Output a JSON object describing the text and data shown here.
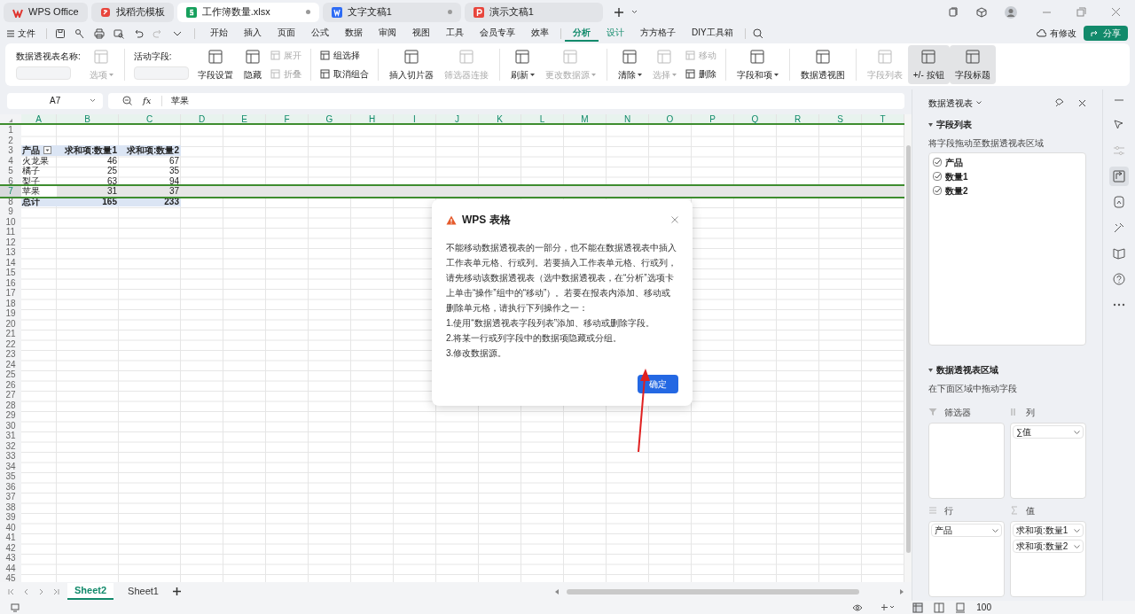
{
  "app_tabs": [
    {
      "label": "WPS Office",
      "kind": "wps",
      "selected": false,
      "unsaved": false
    },
    {
      "label": "找稻壳模板",
      "kind": "template",
      "selected": false,
      "unsaved": false
    },
    {
      "label": "工作簿数量.xlsx",
      "kind": "sheet",
      "selected": true,
      "unsaved": true
    },
    {
      "label": "文字文稿1",
      "kind": "doc",
      "selected": false,
      "unsaved": true
    },
    {
      "label": "演示文稿1",
      "kind": "slides",
      "selected": false,
      "unsaved": false
    }
  ],
  "menu": {
    "file": "文件",
    "tabs": [
      {
        "label": "开始",
        "selected": false,
        "contextual": false
      },
      {
        "label": "插入",
        "selected": false,
        "contextual": false
      },
      {
        "label": "页面",
        "selected": false,
        "contextual": false
      },
      {
        "label": "公式",
        "selected": false,
        "contextual": false
      },
      {
        "label": "数据",
        "selected": false,
        "contextual": false
      },
      {
        "label": "审阅",
        "selected": false,
        "contextual": false
      },
      {
        "label": "视图",
        "selected": false,
        "contextual": false
      },
      {
        "label": "工具",
        "selected": false,
        "contextual": false
      },
      {
        "label": "会员专享",
        "selected": false,
        "contextual": false
      },
      {
        "label": "效率",
        "selected": false,
        "contextual": false
      },
      {
        "label": "分析",
        "selected": true,
        "contextual": true
      },
      {
        "label": "设计",
        "selected": false,
        "contextual": true
      },
      {
        "label": "方方格子",
        "selected": false,
        "contextual": false
      },
      {
        "label": "DIY工具箱",
        "selected": false,
        "contextual": false
      }
    ],
    "cloud_status": "有修改",
    "share": "分享"
  },
  "ribbon": [
    {
      "kind": "field",
      "label": "数据透视表名称:"
    },
    {
      "kind": "large",
      "label": "选项",
      "disabled": true,
      "caret": true
    },
    {
      "kind": "separator"
    },
    {
      "kind": "field",
      "label": "活动字段:"
    },
    {
      "kind": "large",
      "label": "字段设置",
      "disabled": false,
      "caret": false
    },
    {
      "kind": "large",
      "label": "隐藏",
      "disabled": false,
      "caret": false
    },
    {
      "kind": "stack",
      "items": [
        {
          "label": "展开",
          "disabled": true
        },
        {
          "label": "折叠",
          "disabled": true
        }
      ]
    },
    {
      "kind": "separator"
    },
    {
      "kind": "stack",
      "items": [
        {
          "label": "组选择",
          "disabled": false
        },
        {
          "label": "取消组合",
          "disabled": false
        }
      ]
    },
    {
      "kind": "separator"
    },
    {
      "kind": "large",
      "label": "插入切片器",
      "disabled": false,
      "caret": false
    },
    {
      "kind": "large",
      "label": "筛选器连接",
      "disabled": true,
      "caret": false
    },
    {
      "kind": "separator"
    },
    {
      "kind": "large",
      "label": "刷新",
      "disabled": false,
      "caret": true
    },
    {
      "kind": "large",
      "label": "更改数据源",
      "disabled": true,
      "caret": true
    },
    {
      "kind": "separator"
    },
    {
      "kind": "large",
      "label": "清除",
      "disabled": false,
      "caret": true
    },
    {
      "kind": "large",
      "label": "选择",
      "disabled": true,
      "caret": true
    },
    {
      "kind": "stack",
      "items": [
        {
          "label": "移动",
          "disabled": true
        },
        {
          "label": "删除",
          "disabled": false
        }
      ]
    },
    {
      "kind": "separator"
    },
    {
      "kind": "large",
      "label": "字段和项",
      "disabled": false,
      "caret": true
    },
    {
      "kind": "separator"
    },
    {
      "kind": "large",
      "label": "数据透视图",
      "disabled": false,
      "caret": false
    },
    {
      "kind": "separator"
    },
    {
      "kind": "toggle",
      "label": "字段列表",
      "disabled": true,
      "pressed": false
    },
    {
      "kind": "toggle",
      "label": "+/- 按钮",
      "disabled": false,
      "pressed": true
    },
    {
      "kind": "toggle",
      "label": "字段标题",
      "disabled": false,
      "pressed": true
    }
  ],
  "formula_bar": {
    "cell_ref": "A7",
    "fx": "fx",
    "value": "苹果"
  },
  "sheet": {
    "columns": [
      "A",
      "B",
      "C",
      "D",
      "E",
      "F",
      "G",
      "H",
      "I",
      "J",
      "K",
      "L",
      "M",
      "N",
      "O",
      "P",
      "Q",
      "R",
      "S",
      "T"
    ],
    "rows": [
      {
        "number": "1"
      },
      {
        "number": "2"
      },
      {
        "number": "3",
        "kind": "header",
        "selected": false,
        "cells": [
          "产品",
          "求和项:数量1",
          "求和项:数量2"
        ]
      },
      {
        "number": "4",
        "kind": "item",
        "selected": false,
        "cells": [
          "火龙果",
          "46",
          "67"
        ]
      },
      {
        "number": "5",
        "kind": "item",
        "selected": false,
        "cells": [
          "橘子",
          "25",
          "35"
        ]
      },
      {
        "number": "6",
        "kind": "item",
        "selected": false,
        "cells": [
          "梨子",
          "63",
          "94"
        ]
      },
      {
        "number": "7",
        "kind": "item",
        "selected": true,
        "cells": [
          "苹果",
          "31",
          "37"
        ]
      },
      {
        "number": "8",
        "kind": "total",
        "selected": false,
        "cells": [
          "总计",
          "165",
          "233"
        ]
      },
      {
        "number": "9"
      },
      {
        "number": "10"
      },
      {
        "number": "11"
      },
      {
        "number": "12"
      },
      {
        "number": "13"
      },
      {
        "number": "14"
      },
      {
        "number": "15"
      },
      {
        "number": "16"
      },
      {
        "number": "17"
      },
      {
        "number": "18"
      },
      {
        "number": "19"
      },
      {
        "number": "20"
      },
      {
        "number": "21"
      },
      {
        "number": "22"
      },
      {
        "number": "23"
      },
      {
        "number": "24"
      },
      {
        "number": "25"
      },
      {
        "number": "26"
      },
      {
        "number": "27"
      },
      {
        "number": "28"
      },
      {
        "number": "29"
      },
      {
        "number": "30"
      },
      {
        "number": "31"
      },
      {
        "number": "32"
      },
      {
        "number": "33"
      },
      {
        "number": "34"
      },
      {
        "number": "35"
      },
      {
        "number": "36"
      },
      {
        "number": "37"
      },
      {
        "number": "38"
      },
      {
        "number": "39"
      },
      {
        "number": "40"
      },
      {
        "number": "41"
      },
      {
        "number": "42"
      },
      {
        "number": "43"
      },
      {
        "number": "44"
      },
      {
        "number": "45"
      }
    ]
  },
  "sheet_tabs": [
    {
      "label": "Sheet2",
      "selected": true
    },
    {
      "label": "Sheet1",
      "selected": false
    }
  ],
  "zoom": "100",
  "panel": {
    "title": "数据透视表",
    "field_section": "字段列表",
    "field_hint": "将字段拖动至数据透视表区域",
    "fields": [
      {
        "label": "产品",
        "checked": true
      },
      {
        "label": "数量1",
        "checked": true
      },
      {
        "label": "数量2",
        "checked": true
      }
    ],
    "area_section": "数据透视表区域",
    "area_hint": "在下面区域中拖动字段",
    "areas": [
      {
        "kind": "filter",
        "label": "筛选器"
      },
      {
        "kind": "columns",
        "label": "列",
        "items": [
          "∑值"
        ]
      },
      {
        "kind": "rows",
        "label": "行",
        "items": [
          "产品"
        ]
      },
      {
        "kind": "values",
        "label": "值",
        "items": [
          "求和项:数量1",
          "求和项:数量2"
        ]
      }
    ]
  },
  "dialog": {
    "title": "WPS 表格",
    "message": "不能移动数据透视表的一部分，也不能在数据透视表中插入工作表单元格、行或列。若要插入工作表单元格、行或列，请先移动该数据透视表（选中数据透视表，在“分析”选项卡上单击“操作”组中的“移动”）。若要在报表内添加、移动或删除单元格，请执行下列操作之一：",
    "steps": [
      "1.使用“数据透视表字段列表”添加、移动或删除字段。",
      "2.将某一行或列字段中的数据项隐藏或分组。",
      "3.修改数据源。"
    ],
    "ok": "确定"
  }
}
